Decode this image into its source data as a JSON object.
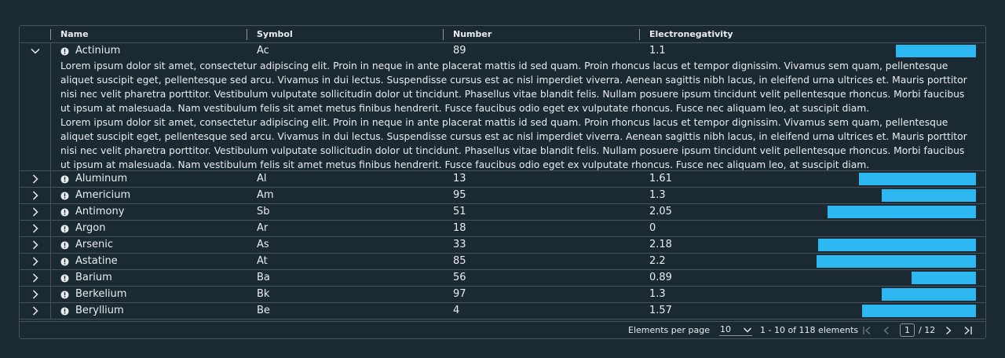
{
  "columns": {
    "name": "Name",
    "symbol": "Symbol",
    "number": "Number",
    "electronegativity": "Electronegativity"
  },
  "colors": {
    "bar": "#2db8f2",
    "background": "#1b2a32",
    "border": "#47535b"
  },
  "bar_max": 2.6,
  "expanded": {
    "name": "Actinium",
    "symbol": "Ac",
    "number": "89",
    "electronegativity": "1.1",
    "detail_p1": "Lorem ipsum dolor sit amet, consectetur adipiscing elit. Proin in neque in ante placerat mattis id sed quam. Proin rhoncus lacus et tempor dignissim. Vivamus sem quam, pellentesque aliquet suscipit eget, pellentesque sed arcu. Vivamus in dui lectus. Suspendisse cursus est ac nisl imperdiet viverra. Aenean sagittis nibh lacus, in eleifend urna ultrices et. Mauris porttitor nisi nec velit pharetra porttitor. Vestibulum vulputate sollicitudin dolor ut tincidunt. Phasellus vitae blandit felis. Nullam posuere ipsum tincidunt velit pellentesque rhoncus. Morbi faucibus ut ipsum at malesuada. Nam vestibulum felis sit amet metus finibus hendrerit. Fusce faucibus odio eget ex vulputate rhoncus. Fusce nec aliquam leo, at suscipit diam.",
    "detail_p2": "Lorem ipsum dolor sit amet, consectetur adipiscing elit. Proin in neque in ante placerat mattis id sed quam. Proin rhoncus lacus et tempor dignissim. Vivamus sem quam, pellentesque aliquet suscipit eget, pellentesque sed arcu. Vivamus in dui lectus. Suspendisse cursus est ac nisl imperdiet viverra. Aenean sagittis nibh lacus, in eleifend urna ultrices et. Mauris porttitor nisi nec velit pharetra porttitor. Vestibulum vulputate sollicitudin dolor ut tincidunt. Phasellus vitae blandit felis. Nullam posuere ipsum tincidunt velit pellentesque rhoncus. Morbi faucibus ut ipsum at malesuada. Nam vestibulum felis sit amet metus finibus hendrerit. Fusce faucibus odio eget ex vulputate rhoncus. Fusce nec aliquam leo, at suscipit diam."
  },
  "rows": [
    {
      "name": "Aluminum",
      "symbol": "Al",
      "number": "13",
      "electronegativity": "1.61"
    },
    {
      "name": "Americium",
      "symbol": "Am",
      "number": "95",
      "electronegativity": "1.3"
    },
    {
      "name": "Antimony",
      "symbol": "Sb",
      "number": "51",
      "electronegativity": "2.05"
    },
    {
      "name": "Argon",
      "symbol": "Ar",
      "number": "18",
      "electronegativity": "0"
    },
    {
      "name": "Arsenic",
      "symbol": "As",
      "number": "33",
      "electronegativity": "2.18"
    },
    {
      "name": "Astatine",
      "symbol": "At",
      "number": "85",
      "electronegativity": "2.2"
    },
    {
      "name": "Barium",
      "symbol": "Ba",
      "number": "56",
      "electronegativity": "0.89"
    },
    {
      "name": "Berkelium",
      "symbol": "Bk",
      "number": "97",
      "electronegativity": "1.3"
    },
    {
      "name": "Beryllium",
      "symbol": "Be",
      "number": "4",
      "electronegativity": "1.57"
    }
  ],
  "footer": {
    "per_page_label": "Elements per page",
    "per_page_value": "10",
    "range_text": "1 - 10 of 118 elements",
    "current_page": "1",
    "total_pages": "/ 12"
  },
  "icons": {
    "expand": "chevron-right-icon",
    "collapse": "chevron-down-icon",
    "warning": "exclamation-circle-icon",
    "first": "first-page-icon",
    "prev": "previous-page-icon",
    "next": "next-page-icon",
    "last": "last-page-icon"
  }
}
